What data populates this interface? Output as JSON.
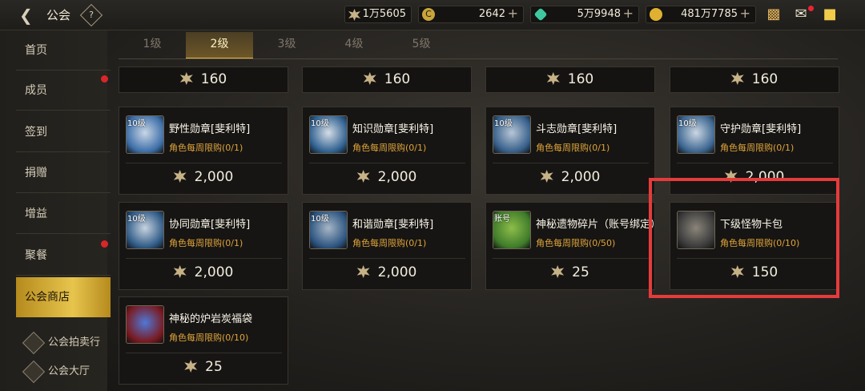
{
  "header": {
    "title": "公会",
    "help": "?",
    "currencies": [
      {
        "name": "honor",
        "value": "1万5605",
        "plus": "",
        "color": "#c7b287"
      },
      {
        "name": "coin",
        "value": "2642",
        "plus": "+",
        "color": "#d8b446"
      },
      {
        "name": "gem",
        "value": "5万9948",
        "plus": "+",
        "color": "#3fc7a0"
      },
      {
        "name": "gold",
        "value": "481万7785",
        "plus": "+",
        "color": "#e0b030"
      }
    ]
  },
  "sidebar": {
    "items": [
      {
        "label": "首页"
      },
      {
        "label": "成员"
      },
      {
        "label": "签到"
      },
      {
        "label": "捐赠"
      },
      {
        "label": "增益"
      },
      {
        "label": "聚餐"
      },
      {
        "label": "公会商店"
      }
    ],
    "links": [
      {
        "label": "公会拍卖行"
      },
      {
        "label": "公会大厅"
      }
    ]
  },
  "tabs": [
    {
      "label": "1级"
    },
    {
      "label": "2级"
    },
    {
      "label": "3级"
    },
    {
      "label": "4级"
    },
    {
      "label": "5级"
    }
  ],
  "top_prices": [
    "160",
    "160",
    "160",
    "160"
  ],
  "cards": [
    {
      "name": "野性勋章[斐利特]",
      "level": "10级",
      "limit": "角色每周限购(0/1)",
      "price": "2,000",
      "colorA": "#3c6ea8",
      "colorB": "#c9d6e6"
    },
    {
      "name": "知识勋章[斐利特]",
      "level": "10级",
      "limit": "角色每周限购(0/1)",
      "price": "2,000",
      "colorA": "#2f6090",
      "colorB": "#d5dde6"
    },
    {
      "name": "斗志勋章[斐利特]",
      "level": "10级",
      "limit": "角色每周限购(0/1)",
      "price": "2,000",
      "colorA": "#365f8a",
      "colorB": "#b8c6d6"
    },
    {
      "name": "守护勋章[斐利特]",
      "level": "10级",
      "limit": "角色每周限购(0/1)",
      "price": "2,000",
      "colorA": "#3b6590",
      "colorB": "#cbd6e2"
    },
    {
      "name": "协同勋章[斐利特]",
      "level": "10级",
      "limit": "角色每周限购(0/1)",
      "price": "2,000",
      "colorA": "#2e5a86",
      "colorB": "#c7d3df"
    },
    {
      "name": "和谐勋章[斐利特]",
      "level": "10级",
      "limit": "角色每周限购(0/1)",
      "price": "2,000",
      "colorA": "#2c5580",
      "colorB": "#a7b6c6"
    },
    {
      "name": "神秘遗物碎片（账号绑定）",
      "level": "账号",
      "limit": "角色每周限购(0/50)",
      "price": "25",
      "colorA": "#3f7b2a",
      "colorB": "#8dbd4a"
    },
    {
      "name": "下级怪物卡包",
      "level": "",
      "limit": "角色每周限购(0/10)",
      "price": "150",
      "colorA": "#3a3a3a",
      "colorB": "#8a857a"
    },
    {
      "name": "神秘的炉岩炭福袋",
      "level": "",
      "limit": "角色每周限购(0/10)",
      "price": "25",
      "colorA": "#7a1a20",
      "colorB": "#4f78d8"
    }
  ]
}
